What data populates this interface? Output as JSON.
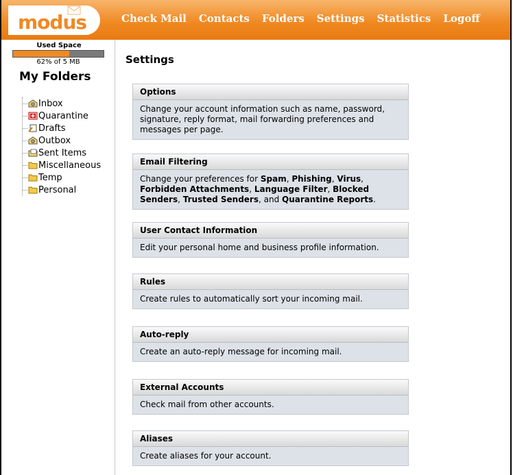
{
  "app": {
    "logo": "modus"
  },
  "nav": {
    "items": [
      "Check Mail",
      "Contacts",
      "Folders",
      "Settings",
      "Statistics",
      "Logoff"
    ]
  },
  "sidebar": {
    "used_space_label": "Used Space",
    "usage_fraction": 0.62,
    "usage_text": "62% of 5 MB",
    "folders_title": "My Folders",
    "folders": [
      {
        "label": "Inbox",
        "icon": "inbox-icon"
      },
      {
        "label": "Quarantine",
        "icon": "quarantine-icon"
      },
      {
        "label": "Drafts",
        "icon": "drafts-icon"
      },
      {
        "label": "Outbox",
        "icon": "outbox-icon"
      },
      {
        "label": "Sent Items",
        "icon": "sent-items-icon"
      },
      {
        "label": "Miscellaneous",
        "icon": "folder-icon"
      },
      {
        "label": "Temp",
        "icon": "folder-icon"
      },
      {
        "label": "Personal",
        "icon": "folder-icon"
      }
    ]
  },
  "main": {
    "title": "Settings",
    "sections": [
      {
        "title": "Options",
        "parts": [
          {
            "t": "Change your account information such as name, password, signature, reply format, mail forwarding preferences and messages per page."
          }
        ]
      },
      {
        "title": "Email Filtering",
        "parts": [
          {
            "t": "Change your preferences for "
          },
          {
            "t": "Spam",
            "b": true
          },
          {
            "t": ", "
          },
          {
            "t": "Phishing",
            "b": true
          },
          {
            "t": ", "
          },
          {
            "t": "Virus",
            "b": true
          },
          {
            "t": ", "
          },
          {
            "t": "Forbidden Attachments",
            "b": true
          },
          {
            "t": ", "
          },
          {
            "t": "Language Filter",
            "b": true
          },
          {
            "t": ", "
          },
          {
            "t": "Blocked Senders",
            "b": true
          },
          {
            "t": ", "
          },
          {
            "t": "Trusted Senders",
            "b": true
          },
          {
            "t": ", and "
          },
          {
            "t": "Quarantine Reports",
            "b": true
          },
          {
            "t": "."
          }
        ]
      },
      {
        "title": "User Contact Information",
        "parts": [
          {
            "t": "Edit your personal home and business profile information."
          }
        ]
      },
      {
        "title": "Rules",
        "parts": [
          {
            "t": "Create rules to automatically sort your incoming mail."
          }
        ]
      },
      {
        "title": "Auto-reply",
        "parts": [
          {
            "t": "Create an auto-reply message for incoming mail."
          }
        ]
      },
      {
        "title": "External Accounts",
        "parts": [
          {
            "t": "Check mail from other accounts."
          }
        ]
      },
      {
        "title": "Aliases",
        "parts": [
          {
            "t": "Create aliases for your account."
          }
        ]
      }
    ]
  },
  "colors": {
    "accent": "#f08a24",
    "card_bg": "#dde2e8",
    "usage_bg": "#7a7a7a"
  }
}
